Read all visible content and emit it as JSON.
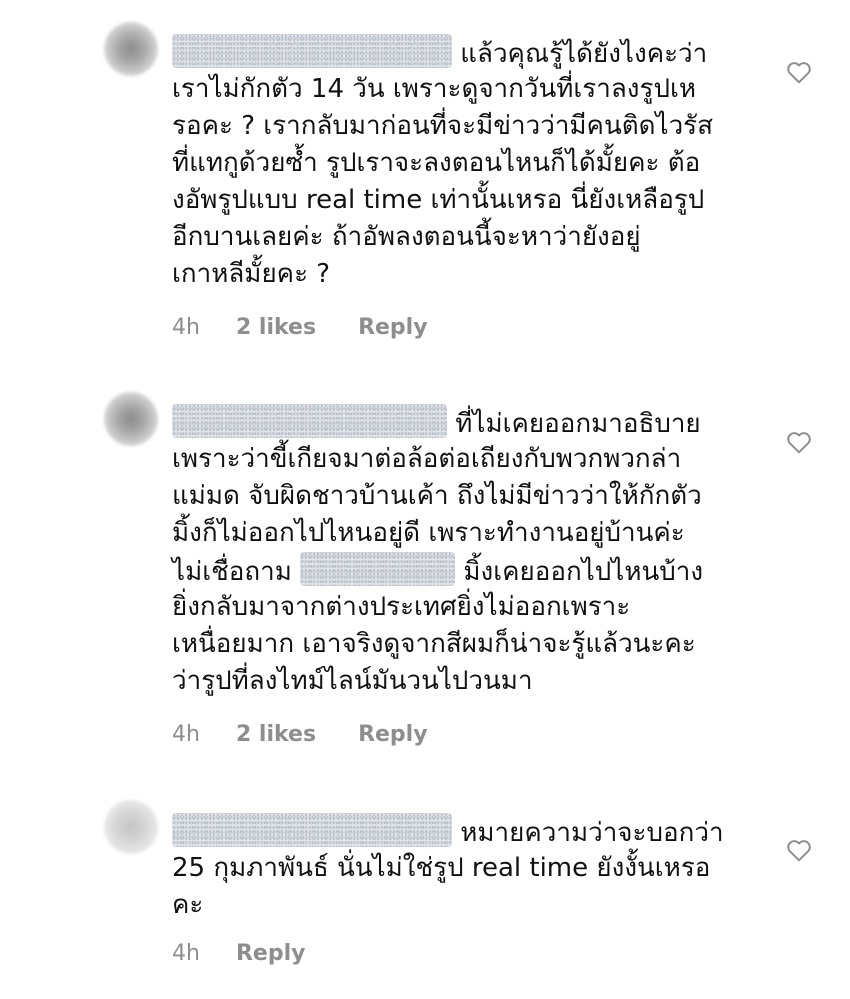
{
  "comments": [
    {
      "lines": [
        "แล้วคุณรู้ได้ยังไงคะว่า",
        "เราไม่กักตัว 14 วัน เพราะดูจากวันที่เราลงรูปเห",
        "รอคะ ? เรากลับมาก่อนที่จะมีข่าวว่ามีคนติดไวรัส",
        "ที่แทกูด้วยซ้ำ รูปเราจะลงตอนไหนก็ได้มั้ยคะ ต้อ",
        "งอัพรูปแบบ real time เท่านั้นเหรอ นี่ยังเหลือรูป",
        "อีกบานเลยค่ะ ถ้าอัพลงตอนนี้จะหาว่ายังอยู่",
        "เกาหลีมั้ยคะ ?"
      ],
      "time": "4h",
      "likes": "2 likes",
      "reply": "Reply"
    },
    {
      "lines": [
        "ที่ไม่เคยออกมาอธิบาย",
        "เพราะว่าขี้เกียจมาต่อล้อต่อเถียงกับพวกพวกล่า",
        "แม่มด จับผิดชาวบ้านเค้า ถึงไม่มีข่าวว่าให้กักตัว",
        "มิ้งก็ไม่ออกไปไหนอยู่ดี เพราะทำงานอยู่บ้านค่ะ",
        "ไม่เชื่อถาม",
        "มิ้งเคยออกไปไหนบ้าง",
        "ยิ่งกลับมาจากต่างประเทศยิ่งไม่ออกเพราะ",
        "เหนื่อยมาก เอาจริงดูจากสีผมก็น่าจะรู้แล้วนะคะ",
        "ว่ารูปที่ลงไทม์ไลน์มันวนไปวนมา"
      ],
      "time": "4h",
      "likes": "2 likes",
      "reply": "Reply"
    },
    {
      "lines": [
        "หมายความว่าจะบอกว่า",
        "25 กุมภาพันธ์ นั่นไม่ใช่รูป real time ยังงั้นเหรอ",
        "คะ"
      ],
      "time": "4h",
      "reply": "Reply"
    }
  ],
  "icons": {
    "like": "heart-outline-icon"
  },
  "colors": {
    "text": "#111111",
    "meta": "#8e8e8e",
    "icon": "#8e8e8e"
  }
}
